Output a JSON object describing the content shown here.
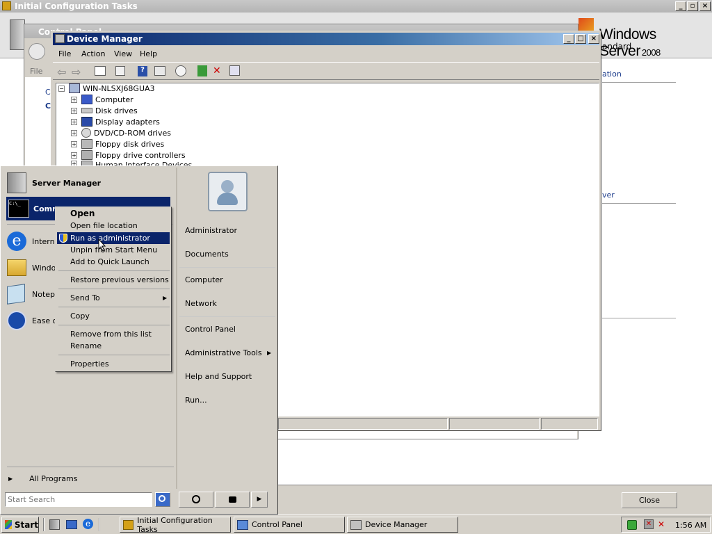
{
  "bg_window": {
    "title": "Initial Configuration Tasks",
    "product_name": "Windows Server",
    "product_version": "2008",
    "product_edition": "andard",
    "link_fragment_1": "ation",
    "link_fragment_2": "ver",
    "close_button": "Close"
  },
  "control_panel": {
    "title": "Control Panel",
    "menu_file": "File"
  },
  "device_manager": {
    "title": "Device Manager",
    "menu": [
      "File",
      "Action",
      "View",
      "Help"
    ],
    "root": "WIN-NLSXJ68GUA3",
    "devices": [
      "Computer",
      "Disk drives",
      "Display adapters",
      "DVD/CD-ROM drives",
      "Floppy disk drives",
      "Floppy drive controllers",
      "Human Interface Devices"
    ]
  },
  "start_menu": {
    "pinned": [
      {
        "label": "Server Manager",
        "icon": "server-icon"
      },
      {
        "label": "Command Prompt",
        "icon": "console-icon"
      },
      {
        "label": "Internet Explorer",
        "icon": "ie-icon"
      },
      {
        "label": "Windows Explorer",
        "icon": "folder-icon"
      },
      {
        "label": "Notepad",
        "icon": "notepad-icon"
      },
      {
        "label": "Ease of Access Center",
        "icon": "ease-icon"
      }
    ],
    "visible_labels": [
      "Server Manager",
      "Comm",
      "Interne",
      "Window",
      "Notepa",
      "Ease o"
    ],
    "all_programs": "All Programs",
    "search_placeholder": "Start Search",
    "right_items": [
      "Administrator",
      "Documents",
      "Computer",
      "Network",
      "Control Panel",
      "Administrative Tools",
      "Help and Support",
      "Run..."
    ]
  },
  "context_menu": {
    "items": [
      "Open",
      "Open file location",
      "Run as administrator",
      "Unpin from Start Menu",
      "Add to Quick Launch",
      "Restore previous versions",
      "Send To",
      "Copy",
      "Remove from this list",
      "Rename",
      "Properties"
    ]
  },
  "taskbar": {
    "start": "Start",
    "tasks": [
      "Initial Configuration Tasks",
      "Control Panel",
      "Device Manager"
    ],
    "clock": "1:56 AM"
  },
  "colors": {
    "title_blue": "#0a246a",
    "highlight": "#0a246a",
    "face": "#d4d0c8"
  }
}
